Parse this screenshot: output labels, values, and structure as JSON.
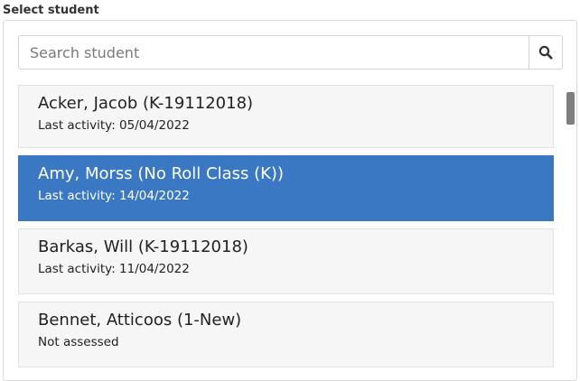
{
  "header": {
    "title": "Select student"
  },
  "search": {
    "placeholder": "Search student",
    "value": ""
  },
  "students": [
    {
      "name": "Acker, Jacob (K-19112018)",
      "detail": "Last activity: 05/04/2022",
      "selected": false
    },
    {
      "name": "Amy, Morss (No Roll Class (K))",
      "detail": "Last activity: 14/04/2022",
      "selected": true
    },
    {
      "name": "Barkas, Will (K-19112018)",
      "detail": "Last activity: 11/04/2022",
      "selected": false
    },
    {
      "name": "Bennet, Atticoos (1-New)",
      "detail": "Not assessed",
      "selected": false
    }
  ],
  "colors": {
    "selected_bg": "#3b78c3",
    "card_bg": "#f6f6f6"
  },
  "icons": {
    "search": "search-icon"
  }
}
